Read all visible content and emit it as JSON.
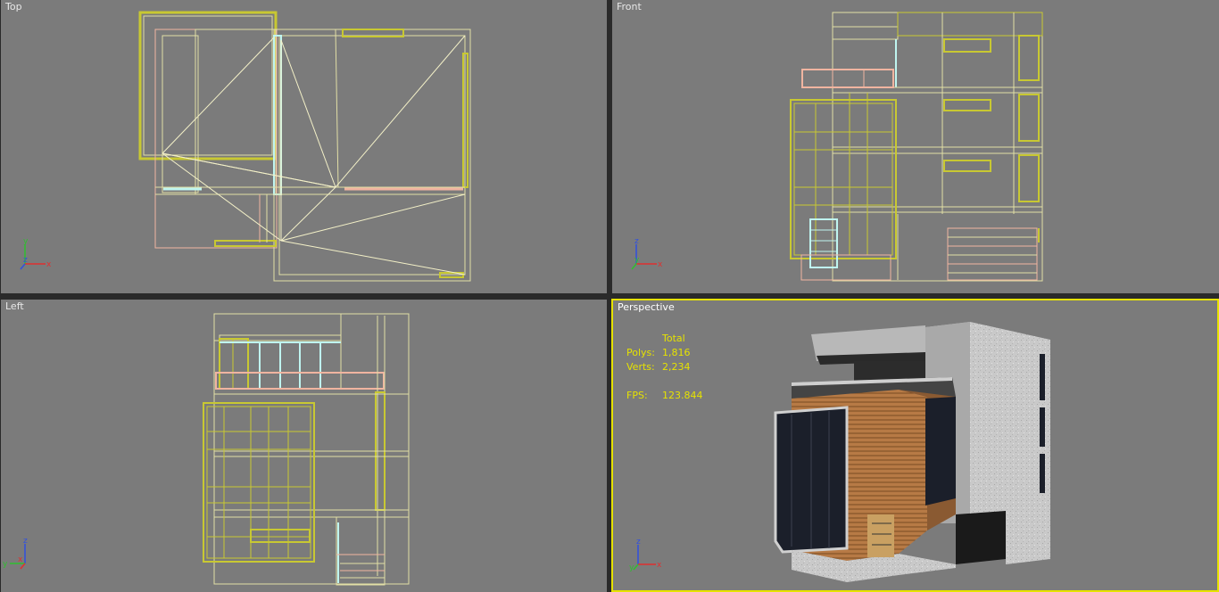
{
  "viewports": {
    "top": {
      "label": "Top"
    },
    "front": {
      "label": "Front"
    },
    "left": {
      "label": "Left"
    },
    "perspective": {
      "label": "Perspective"
    }
  },
  "stats": {
    "header": "Total",
    "polys_label": "Polys:",
    "polys_value": "1,816",
    "verts_label": "Verts:",
    "verts_value": "2,234",
    "fps_label": "FPS:",
    "fps_value": "123.844"
  },
  "axis_labels": {
    "top": {
      "a": "y",
      "b": "z",
      "c": "x"
    },
    "front": {
      "a": "z",
      "b": "y",
      "c": "x"
    },
    "left": {
      "a": "z",
      "b": "x",
      "c": "y"
    },
    "persp": {
      "a": "z",
      "b": "y",
      "c": "x"
    }
  },
  "colors": {
    "viewport_bg": "#7b7b7b",
    "active_border": "#e6e200",
    "wire_yellow": "#c8c832",
    "wire_pale": "#e2dfa6",
    "wire_pink": "#f0b4a0",
    "wire_cyan": "#bff5f0",
    "stats_text": "#e6e200"
  }
}
